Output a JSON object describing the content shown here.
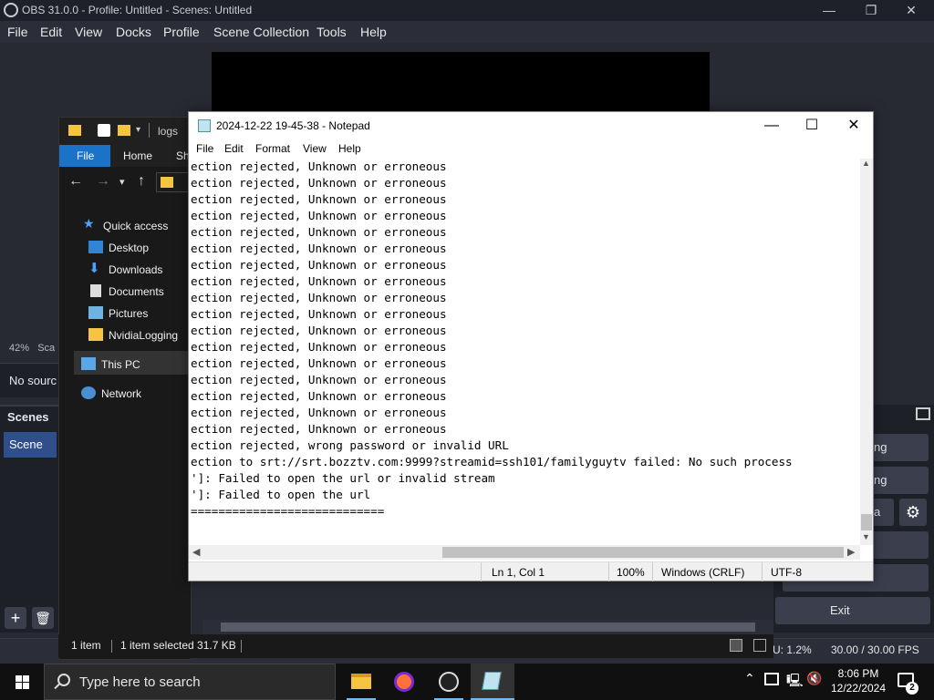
{
  "obs": {
    "title": "OBS 31.0.0 - Profile: Untitled - Scenes: Untitled",
    "menu": [
      "File",
      "Edit",
      "View",
      "Docks",
      "Profile",
      "Scene Collection",
      "Tools",
      "Help"
    ],
    "zoom": "42%",
    "zoom_suffix": "Sca",
    "no_source": "No sourc",
    "scenes_title": "Scenes",
    "scene_item": "Scene",
    "add_glyph": "+",
    "remove_glyph": "🗑",
    "controls": [
      "ng",
      "ng",
      "a"
    ],
    "exit_label": "Exit",
    "status_cpu": "U: 1.2%",
    "status_fps": "30.00 / 30.00 FPS"
  },
  "explorer": {
    "path": "logs",
    "tabs": [
      "File",
      "Home",
      "Sh"
    ],
    "nav": [
      {
        "label": "Quick access",
        "icon": "star-icon"
      },
      {
        "label": "Desktop",
        "icon": "desktop-icon"
      },
      {
        "label": "Downloads",
        "icon": "download-icon"
      },
      {
        "label": "Documents",
        "icon": "document-icon"
      },
      {
        "label": "Pictures",
        "icon": "pictures-icon"
      },
      {
        "label": "NvidiaLogging",
        "icon": "folder-icon"
      },
      {
        "label": "This PC",
        "icon": "pc-icon"
      },
      {
        "label": "Network",
        "icon": "network-icon"
      }
    ],
    "status_items": "1 item",
    "status_selected": "1 item selected  31.7 KB"
  },
  "notepad": {
    "title": "2024-12-22 19-45-38 - Notepad",
    "menu": [
      "File",
      "Edit",
      "Format",
      "View",
      "Help"
    ],
    "lines": [
      "ection rejected, Unknown or erroneous",
      "ection rejected, Unknown or erroneous",
      "ection rejected, Unknown or erroneous",
      "ection rejected, Unknown or erroneous",
      "ection rejected, Unknown or erroneous",
      "ection rejected, Unknown or erroneous",
      "ection rejected, Unknown or erroneous",
      "ection rejected, Unknown or erroneous",
      "ection rejected, Unknown or erroneous",
      "ection rejected, Unknown or erroneous",
      "ection rejected, Unknown or erroneous",
      "ection rejected, Unknown or erroneous",
      "ection rejected, Unknown or erroneous",
      "ection rejected, Unknown or erroneous",
      "ection rejected, Unknown or erroneous",
      "ection rejected, Unknown or erroneous",
      "ection rejected, Unknown or erroneous",
      "ection rejected, wrong password or invalid URL",
      "ection to srt://srt.bozztv.com:9999?streamid=ssh101/familyguytv failed: No such process",
      "']: Failed to open the url or invalid stream",
      "']: Failed to open the url",
      "============================"
    ],
    "status": {
      "position": "Ln 1, Col 1",
      "zoom": "100%",
      "line_ending": "Windows (CRLF)",
      "encoding": "UTF-8"
    }
  },
  "taskbar": {
    "search_placeholder": "Type here to search",
    "time": "8:06 PM",
    "date": "12/22/2024",
    "notification_count": "2"
  }
}
